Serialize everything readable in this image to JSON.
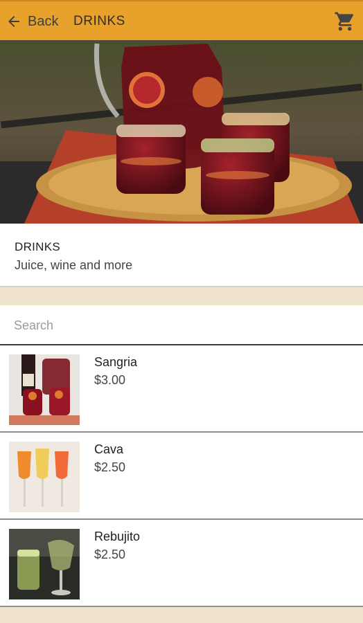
{
  "header": {
    "back_label": "Back",
    "title": "DRINKS",
    "accent_color": "#e8a12a"
  },
  "category": {
    "title": "DRINKS",
    "subtitle": "Juice, wine and more"
  },
  "search": {
    "placeholder": "Search",
    "value": ""
  },
  "products": [
    {
      "name": "Sangria",
      "price": "$3.00"
    },
    {
      "name": "Cava",
      "price": "$2.50"
    },
    {
      "name": "Rebujito",
      "price": "$2.50"
    }
  ]
}
